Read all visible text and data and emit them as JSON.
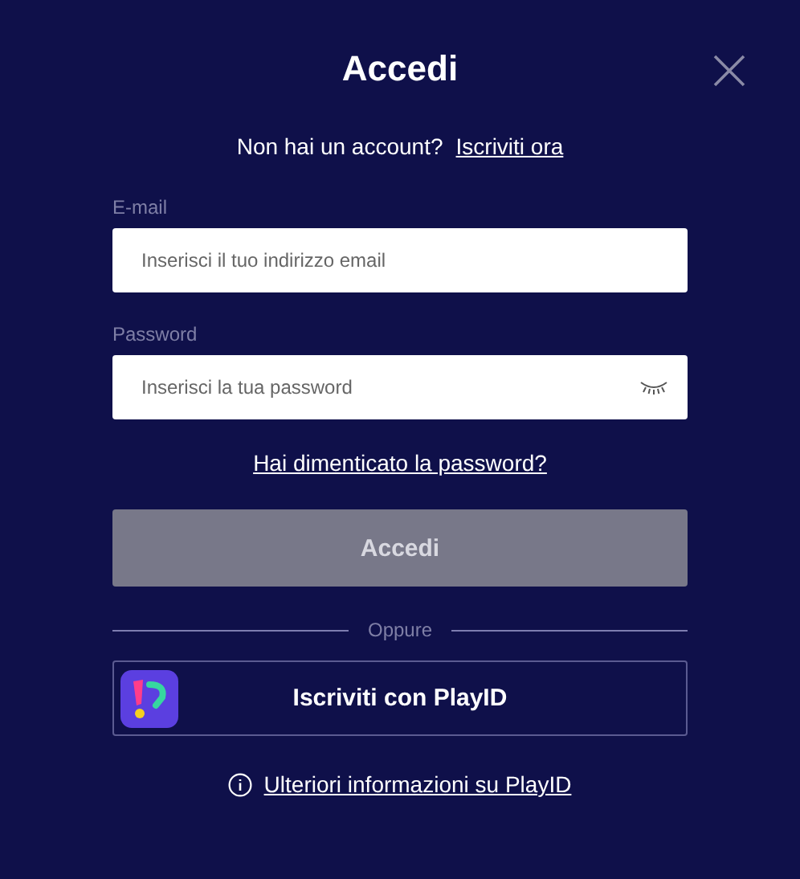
{
  "title": "Accedi",
  "signup": {
    "text": "Non hai un account?",
    "link": "Iscriviti ora"
  },
  "fields": [
    {
      "kind": "email",
      "label": "E-mail",
      "placeholder": "Inserisci il tuo indirizzo email"
    },
    {
      "kind": "password",
      "label": "Password",
      "placeholder": "Inserisci la tua password"
    }
  ],
  "forgot_link": "Hai dimenticato la password?",
  "submit": {
    "label": "Accedi",
    "disabled": true
  },
  "divider_text": "Oppure",
  "playid_button": "Iscriviti con PlayID",
  "info_link": "Ulteriori informazioni su PlayID"
}
